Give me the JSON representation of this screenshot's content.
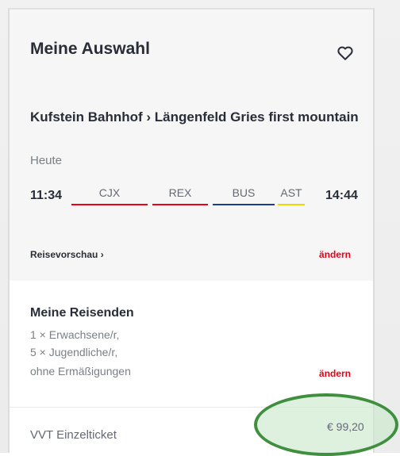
{
  "card": {
    "title": "Meine Auswahl",
    "favorite_icon": "heart-outline-icon"
  },
  "journey": {
    "route": "Kufstein Bahnhof › Längenfeld Gries first mountain",
    "date": "Heute",
    "departure_time": "11:34",
    "arrival_time": "14:44",
    "legs": [
      {
        "label": "CJX",
        "color": "#ec0016"
      },
      {
        "label": "REX",
        "color": "#ec0016"
      },
      {
        "label": "BUS",
        "color": "#1c3d8f"
      },
      {
        "label": "AST",
        "color": "#f2d600"
      }
    ],
    "preview_link": "Reisevorschau ›",
    "change_label": "ändern"
  },
  "travellers": {
    "title": "Meine Reisenden",
    "lines": [
      "1 × Erwachsene/r,",
      "5 × Jugendliche/r,",
      "ohne Ermäßigungen"
    ],
    "change_label": "ändern"
  },
  "ticket": {
    "name": "VVT Einzelticket",
    "price": "€ 99,20",
    "highlight_color": "#3f8f3f"
  }
}
